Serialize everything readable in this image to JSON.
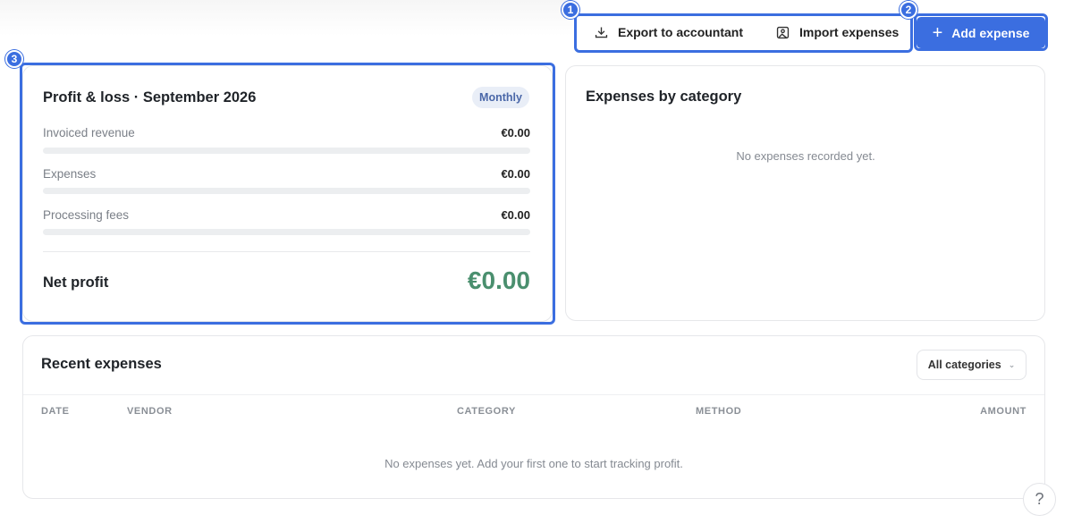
{
  "toolbar": {
    "export_label": "Export to accountant",
    "import_label": "Import expenses",
    "add_label": "Add expense",
    "annotations": [
      "1",
      "2",
      "3"
    ]
  },
  "pl_card": {
    "title": "Profit & loss · September 2026",
    "period_badge": "Monthly",
    "rows": [
      {
        "label": "Invoiced revenue",
        "value": "€0.00",
        "fill": 0
      },
      {
        "label": "Expenses",
        "value": "€0.00",
        "fill": 0
      },
      {
        "label": "Processing fees",
        "value": "€0.00",
        "fill": 0
      }
    ],
    "net_label": "Net profit",
    "net_value": "€0.00"
  },
  "category_card": {
    "title": "Expenses by category",
    "empty_text": "No expenses recorded yet."
  },
  "recent": {
    "title": "Recent expenses",
    "filter_value": "All categories",
    "columns": [
      "DATE",
      "VENDOR",
      "CATEGORY",
      "METHOD",
      "AMOUNT"
    ],
    "empty_text": "No expenses yet. Add your first one to start tracking profit."
  },
  "help": {
    "label": "?"
  },
  "colors": {
    "accent": "#3b6ee0",
    "profit_green": "#4a8f6e",
    "badge_bg": "#e9eef7"
  },
  "icons": {
    "export": "download-icon",
    "import": "image-import-icon",
    "add": "plus-icon",
    "filter": "chevron-down-icon",
    "help": "question-icon"
  }
}
